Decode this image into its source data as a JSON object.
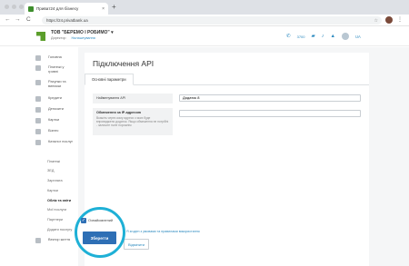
{
  "browser": {
    "tab_title": "Приват24 для бізнесу",
    "tab_close": "×",
    "new_tab": "+",
    "url": "https://24.privatbank.ua",
    "back": "←",
    "forward": "→",
    "reload": "C",
    "star": "☆",
    "menu": "⋮"
  },
  "header": {
    "company": "ТОВ \"БЕРЕМО І РОБИМО\" ▾",
    "role": "Директор",
    "settings_link": "Налаштування",
    "phone_label": "3700",
    "lang": "UA"
  },
  "sidebar": {
    "items": [
      {
        "label": "Головна"
      },
      {
        "label": "Платежі у гривні"
      },
      {
        "label": "Рахунки та виписки"
      },
      {
        "label": "Кредити"
      },
      {
        "label": "Депозити"
      },
      {
        "label": "Картки"
      },
      {
        "label": "Бізнес"
      },
      {
        "label": "Каталог послуг"
      }
    ],
    "sub_items": [
      {
        "label": "Платежі"
      },
      {
        "label": "ЗЕД"
      },
      {
        "label": "Зарплата"
      },
      {
        "label": "Картки"
      },
      {
        "label": "Облік та звіти"
      },
      {
        "label": "Мої послуги"
      },
      {
        "label": "Партнери"
      },
      {
        "label": "Додати послугу"
      },
      {
        "label": "Вектор життя"
      }
    ]
  },
  "main": {
    "title": "Підключення API",
    "tab_label": "Основні параметри",
    "fields": [
      {
        "label": "Найменування API",
        "value": "Додаток 8"
      },
      {
        "label": "Обмеження за IP-адресою",
        "help": "Вкажіть через кому адреси з яких буде впроваджено додаток. Якщо обмеження не потрібні - залиште поле порожнім",
        "value": ""
      }
    ],
    "checkbox_label": "Ознайомлений",
    "agree_text": "Я згоден з умовами та правилами використання",
    "save_button": "Зберегти",
    "cancel_button": "Відмінити"
  },
  "colors": {
    "accent": "#2e6fb5",
    "spotlight": "#1eb0d6",
    "logo": "#5b9e2b"
  },
  "icons": [
    "home-icon",
    "payments-icon",
    "accounts-icon",
    "credit-icon",
    "deposit-icon",
    "card-icon",
    "business-icon",
    "catalog-icon",
    "phone-icon",
    "chat-icon",
    "bell-icon",
    "education-icon",
    "avatar",
    "check-icon"
  ]
}
